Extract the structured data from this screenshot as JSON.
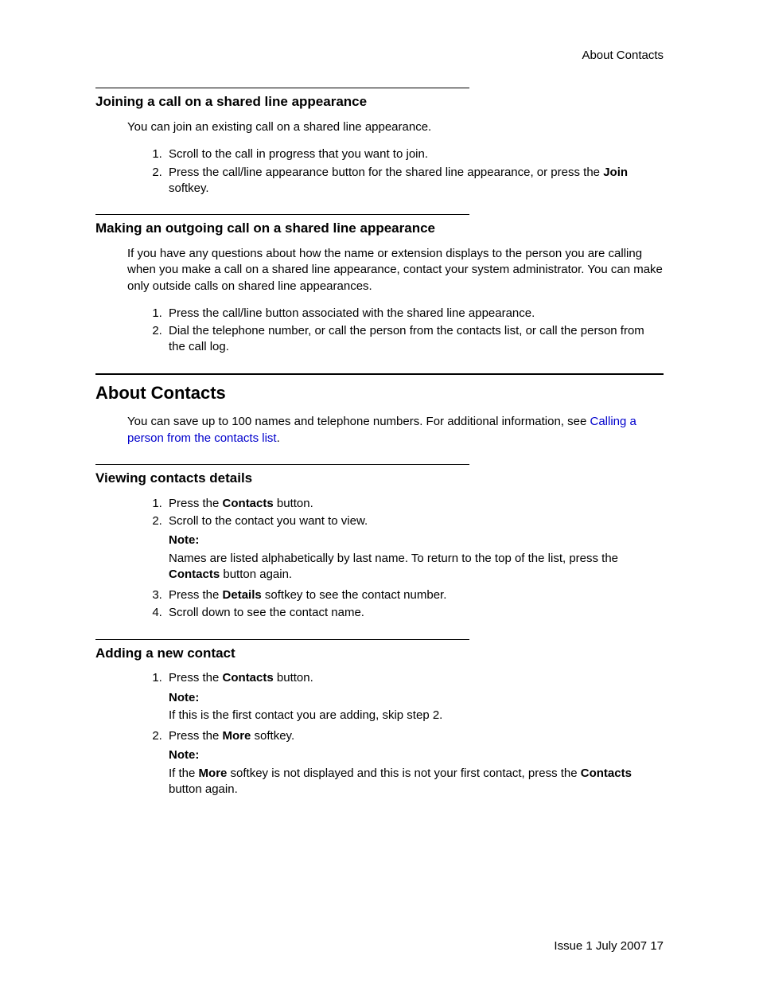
{
  "header": {
    "right": "About Contacts"
  },
  "sections": {
    "joining": {
      "title": "Joining a call on a shared line appearance",
      "para": "You can join an existing call on a shared line appearance.",
      "step1": "Scroll to the call in progress that you want to join.",
      "step2_pre": "Press the call/line appearance button for the shared line appearance, or press the ",
      "step2_bold": "Join",
      "step2_post": " softkey."
    },
    "making": {
      "title": "Making an outgoing call on a shared line appearance",
      "para": "If you have any questions about how the name or extension displays to the person you are calling when you make a call on a shared line appearance, contact your system administrator. You can make only outside calls on shared line appearances.",
      "step1": "Press the call/line button associated with the shared line appearance.",
      "step2": "Dial the telephone number, or call the person from the contacts list, or call the person from the call log."
    },
    "about": {
      "title": "About Contacts",
      "para_pre": "You can save up to 100 names and telephone numbers. For additional information, see ",
      "link": "Calling a person from the contacts list",
      "para_post": "."
    },
    "viewing": {
      "title": "Viewing contacts details",
      "step1_pre": "Press the ",
      "step1_bold": "Contacts",
      "step1_post": " button.",
      "step2": "Scroll to the contact you want to view.",
      "note_label": "Note:",
      "note_body_pre": "Names are listed alphabetically by last name. To return to the top of the list, press the ",
      "note_body_bold": "Contacts",
      "note_body_post": " button again.",
      "step3_pre": "Press the ",
      "step3_bold": "Details",
      "step3_post": " softkey to see the contact number.",
      "step4": "Scroll down to see the contact name."
    },
    "adding": {
      "title": "Adding a new contact",
      "step1_pre": "Press the ",
      "step1_bold": "Contacts",
      "step1_post": " button.",
      "note1_label": "Note:",
      "note1_body": "If this is the first contact you are adding, skip step 2.",
      "step2_pre": "Press the ",
      "step2_bold": "More",
      "step2_post": " softkey.",
      "note2_label": "Note:",
      "note2_pre": "If the ",
      "note2_bold1": "More",
      "note2_mid": " softkey is not displayed and this is not your first contact, press the ",
      "note2_bold2": "Contacts",
      "note2_post": " button again."
    }
  },
  "footer": {
    "text": "Issue 1 July 2007  17"
  }
}
